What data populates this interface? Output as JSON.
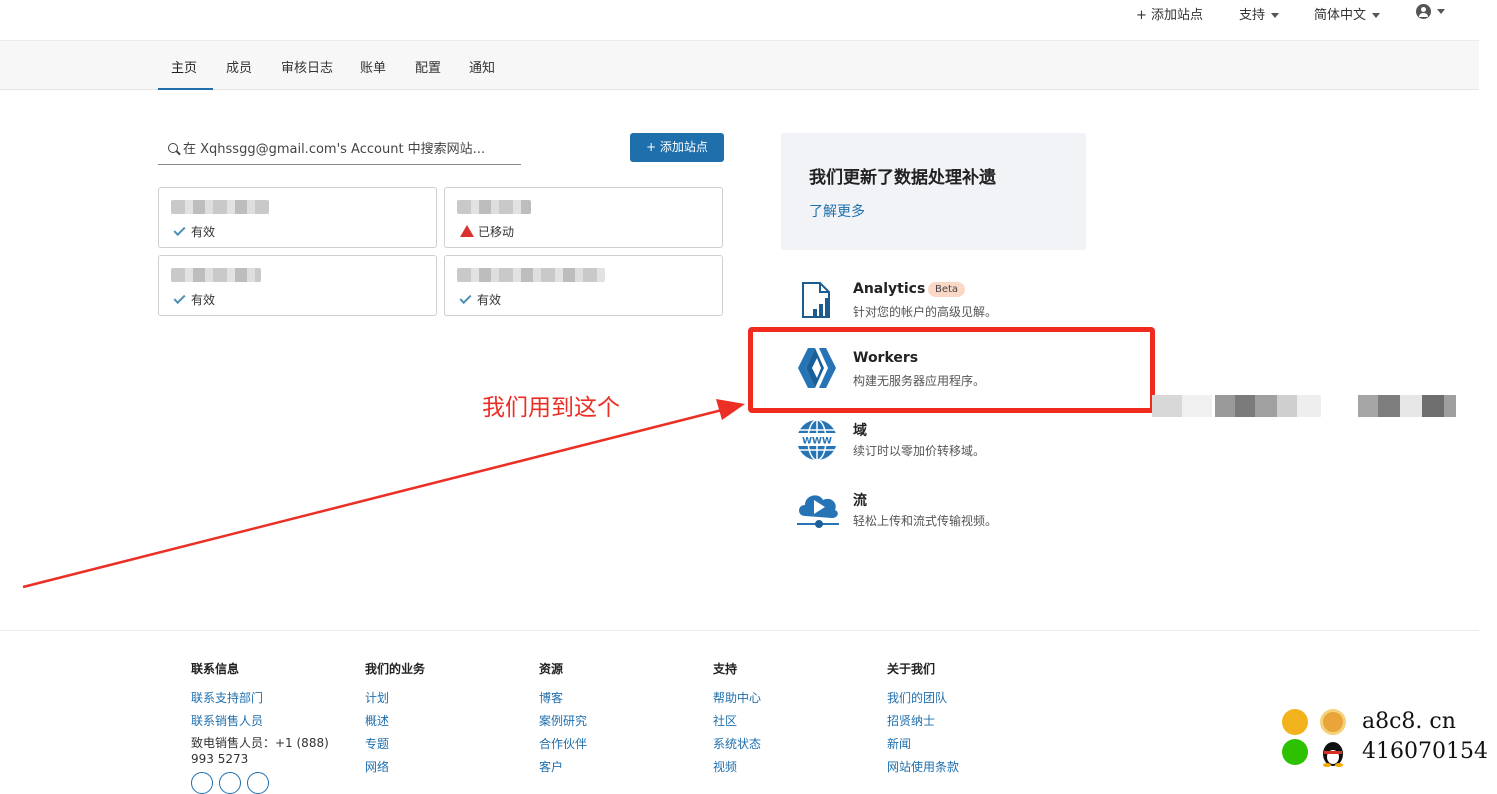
{
  "header": {
    "add_site": "+ 添加站点",
    "support": "支持",
    "language": "简体中文"
  },
  "nav": {
    "tabs": [
      "主页",
      "成员",
      "审核日志",
      "账单",
      "配置",
      "通知"
    ]
  },
  "search": {
    "placeholder": "在 Xqhssgg@gmail.com's Account 中搜索网站..."
  },
  "add_site_button": "+ 添加站点",
  "sites": [
    {
      "status": "有效",
      "state": "active"
    },
    {
      "status": "已移动",
      "state": "moved"
    },
    {
      "status": "有效",
      "state": "active"
    },
    {
      "status": "有效",
      "state": "active"
    }
  ],
  "notice": {
    "title": "我们更新了数据处理补遗",
    "link": "了解更多"
  },
  "products": [
    {
      "title": "Analytics",
      "badge": "Beta",
      "desc": "针对您的帐户的高级见解。",
      "icon": "analytics-chart-icon"
    },
    {
      "title": "Workers",
      "desc": "构建无服务器应用程序。",
      "icon": "workers-icon"
    },
    {
      "title": "域",
      "desc": "续订时以零加价转移域。",
      "icon": "globe-www-icon"
    },
    {
      "title": "流",
      "desc": "轻松上传和流式传输视频。",
      "icon": "stream-cloud-play-icon"
    }
  ],
  "annotation": {
    "text": "我们用到这个",
    "color": "#ec2f25"
  },
  "footer": {
    "contact": {
      "heading": "联系信息",
      "links": [
        "联系支持部门",
        "联系销售人员"
      ],
      "phone": "致电销售人员：+1 (888) 993 5273"
    },
    "business": {
      "heading": "我们的业务",
      "links": [
        "计划",
        "概述",
        "专题",
        "网络"
      ]
    },
    "resources": {
      "heading": "资源",
      "links": [
        "博客",
        "案例研究",
        "合作伙伴",
        "客户"
      ]
    },
    "support": {
      "heading": "支持",
      "links": [
        "帮助中心",
        "社区",
        "系统状态",
        "视频"
      ]
    },
    "about": {
      "heading": "关于我们",
      "links": [
        "我们的团队",
        "招贤纳士",
        "新闻",
        "网站使用条款"
      ]
    }
  },
  "watermark": {
    "site": "a8c8. cn",
    "qq": "416070154"
  },
  "colors": {
    "accent": "#1f6fad",
    "highlight": "#f02a1f"
  }
}
